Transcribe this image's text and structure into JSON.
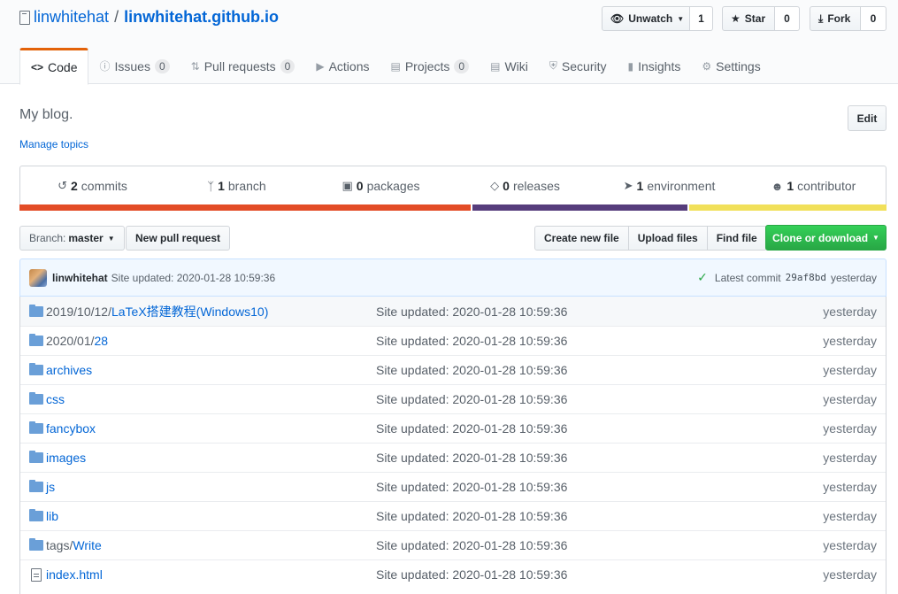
{
  "repo": {
    "owner": "linwhitehat",
    "separator": "/",
    "name": "linwhitehat.github.io"
  },
  "actions": {
    "unwatch": {
      "label": "Unwatch",
      "count": "1"
    },
    "star": {
      "label": "Star",
      "count": "0"
    },
    "fork": {
      "label": "Fork",
      "count": "0"
    }
  },
  "tabs": [
    {
      "label": "Code",
      "icon": "code-icon"
    },
    {
      "label": "Issues",
      "count": "0",
      "icon": "issue-icon"
    },
    {
      "label": "Pull requests",
      "count": "0",
      "icon": "pull-request-icon"
    },
    {
      "label": "Actions",
      "icon": "play-icon"
    },
    {
      "label": "Projects",
      "count": "0",
      "icon": "project-icon"
    },
    {
      "label": "Wiki",
      "icon": "book-icon"
    },
    {
      "label": "Security",
      "icon": "shield-icon"
    },
    {
      "label": "Insights",
      "icon": "graph-icon"
    },
    {
      "label": "Settings",
      "icon": "gear-icon"
    }
  ],
  "description": "My blog.",
  "manage_topics": "Manage topics",
  "edit_label": "Edit",
  "summary": [
    {
      "count": "2",
      "label": "commits",
      "icon": "history-icon"
    },
    {
      "count": "1",
      "label": "branch",
      "icon": "branch-icon"
    },
    {
      "count": "0",
      "label": "packages",
      "icon": "package-icon"
    },
    {
      "count": "0",
      "label": "releases",
      "icon": "tag-icon"
    },
    {
      "count": "1",
      "label": "environment",
      "icon": "rocket-icon"
    },
    {
      "count": "1",
      "label": "contributor",
      "icon": "people-icon"
    }
  ],
  "language_bar": [
    {
      "color": "#e34c26",
      "fraction": 0.52
    },
    {
      "color": "#563d7c",
      "fraction": 0.25
    },
    {
      "color": "#f1e05a",
      "fraction": 0.23
    }
  ],
  "file_nav": {
    "branch_prefix": "Branch:",
    "branch": "master",
    "new_pr": "New pull request",
    "create_file": "Create new file",
    "upload_files": "Upload files",
    "find_file": "Find file",
    "clone": "Clone or download"
  },
  "commit": {
    "author": "linwhitehat",
    "message": "Site updated: 2020-01-28 10:59:36",
    "latest_label": "Latest commit",
    "sha": "29af8bd",
    "age": "yesterday"
  },
  "files": [
    {
      "type": "dir",
      "prefix": "2019/10/12/",
      "name": "LaTeX搭建教程(Windows10)",
      "message": "Site updated: 2020-01-28 10:59:36",
      "age": "yesterday"
    },
    {
      "type": "dir",
      "prefix": "2020/01/",
      "name": "28",
      "message": "Site updated: 2020-01-28 10:59:36",
      "age": "yesterday"
    },
    {
      "type": "dir",
      "prefix": "",
      "name": "archives",
      "message": "Site updated: 2020-01-28 10:59:36",
      "age": "yesterday"
    },
    {
      "type": "dir",
      "prefix": "",
      "name": "css",
      "message": "Site updated: 2020-01-28 10:59:36",
      "age": "yesterday"
    },
    {
      "type": "dir",
      "prefix": "",
      "name": "fancybox",
      "message": "Site updated: 2020-01-28 10:59:36",
      "age": "yesterday"
    },
    {
      "type": "dir",
      "prefix": "",
      "name": "images",
      "message": "Site updated: 2020-01-28 10:59:36",
      "age": "yesterday"
    },
    {
      "type": "dir",
      "prefix": "",
      "name": "js",
      "message": "Site updated: 2020-01-28 10:59:36",
      "age": "yesterday"
    },
    {
      "type": "dir",
      "prefix": "",
      "name": "lib",
      "message": "Site updated: 2020-01-28 10:59:36",
      "age": "yesterday"
    },
    {
      "type": "dir",
      "prefix": "tags/",
      "name": "Write",
      "message": "Site updated: 2020-01-28 10:59:36",
      "age": "yesterday"
    },
    {
      "type": "file",
      "prefix": "",
      "name": "index.html",
      "message": "Site updated: 2020-01-28 10:59:36",
      "age": "yesterday"
    }
  ]
}
